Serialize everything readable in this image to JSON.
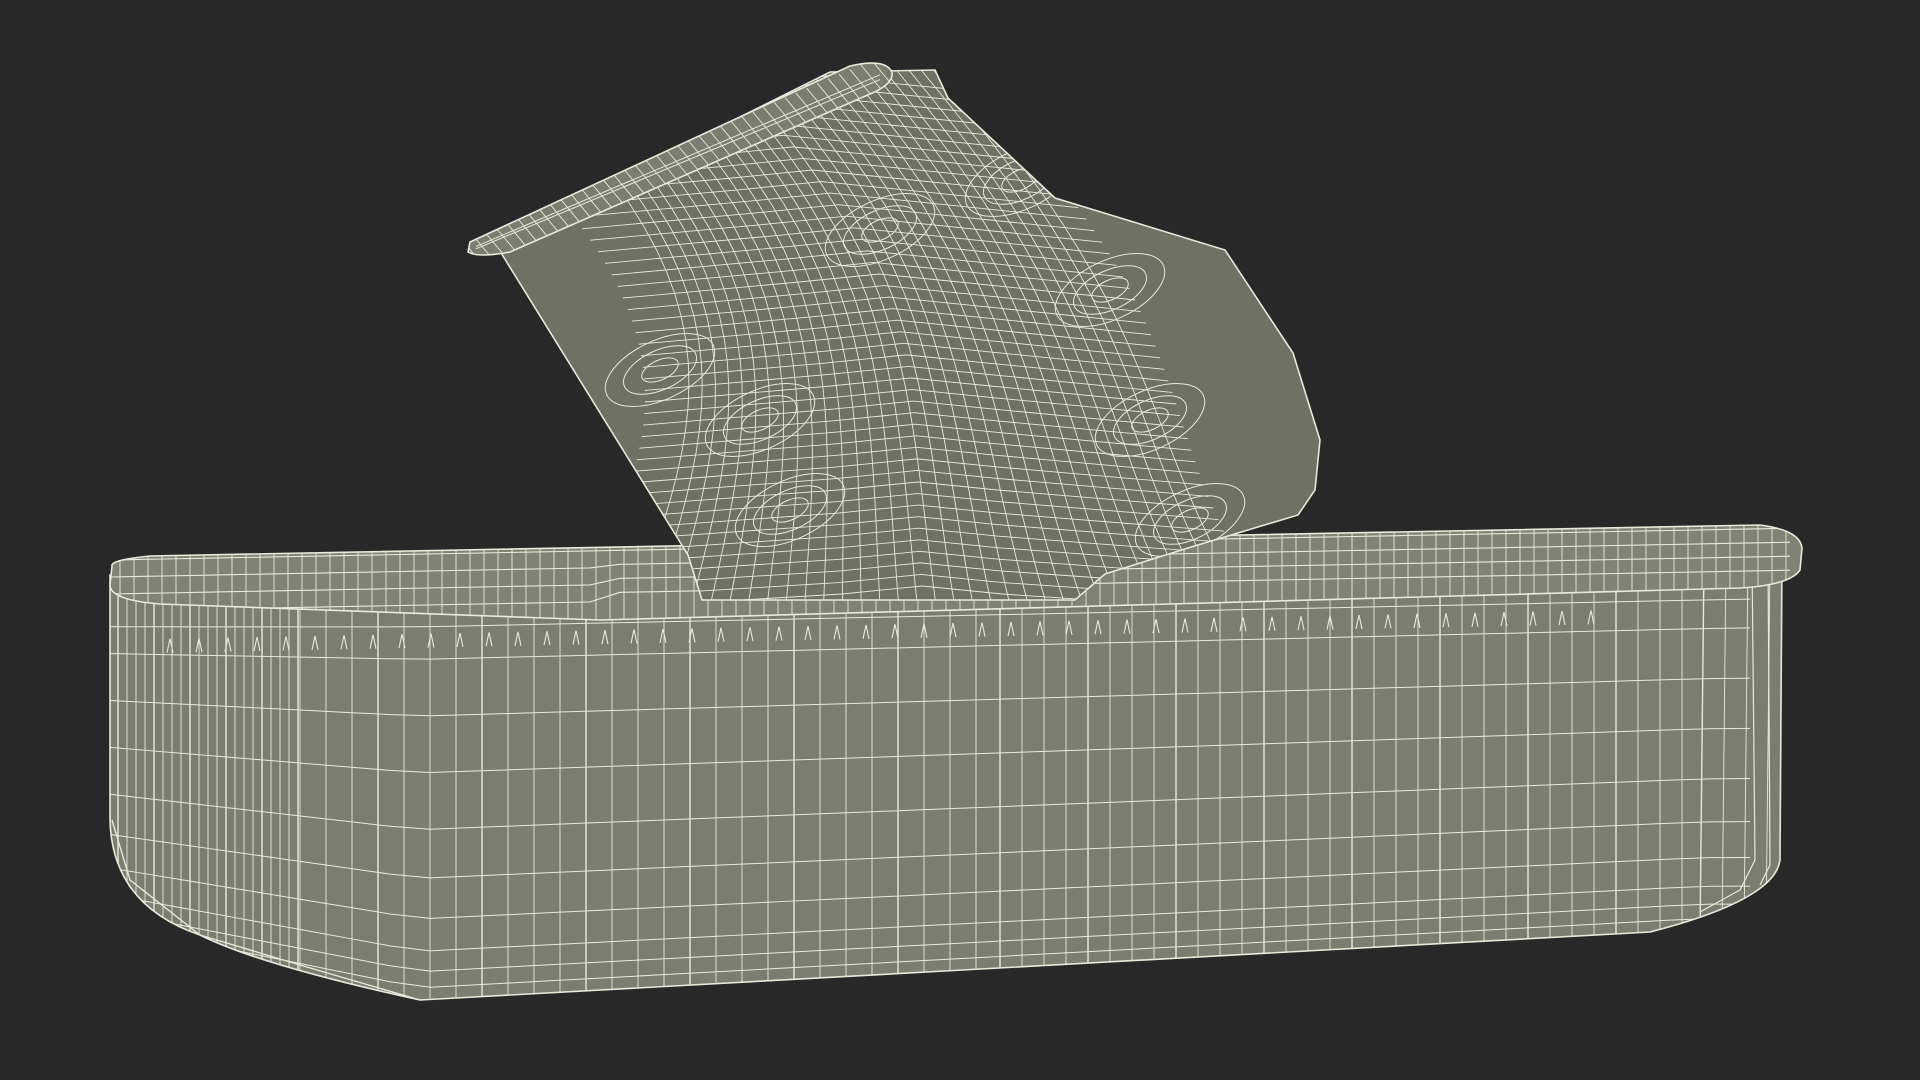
{
  "scene": {
    "subject": "open-sardine-tin-wireframe",
    "colors": {
      "background": "#282828",
      "surface": "#7b7d72",
      "surface_dark": "#6f7166",
      "rim_top": "#808276",
      "interior": "#1f2019",
      "wire": "#e9e8dc",
      "wire_soft": "#d9d8cb"
    }
  }
}
